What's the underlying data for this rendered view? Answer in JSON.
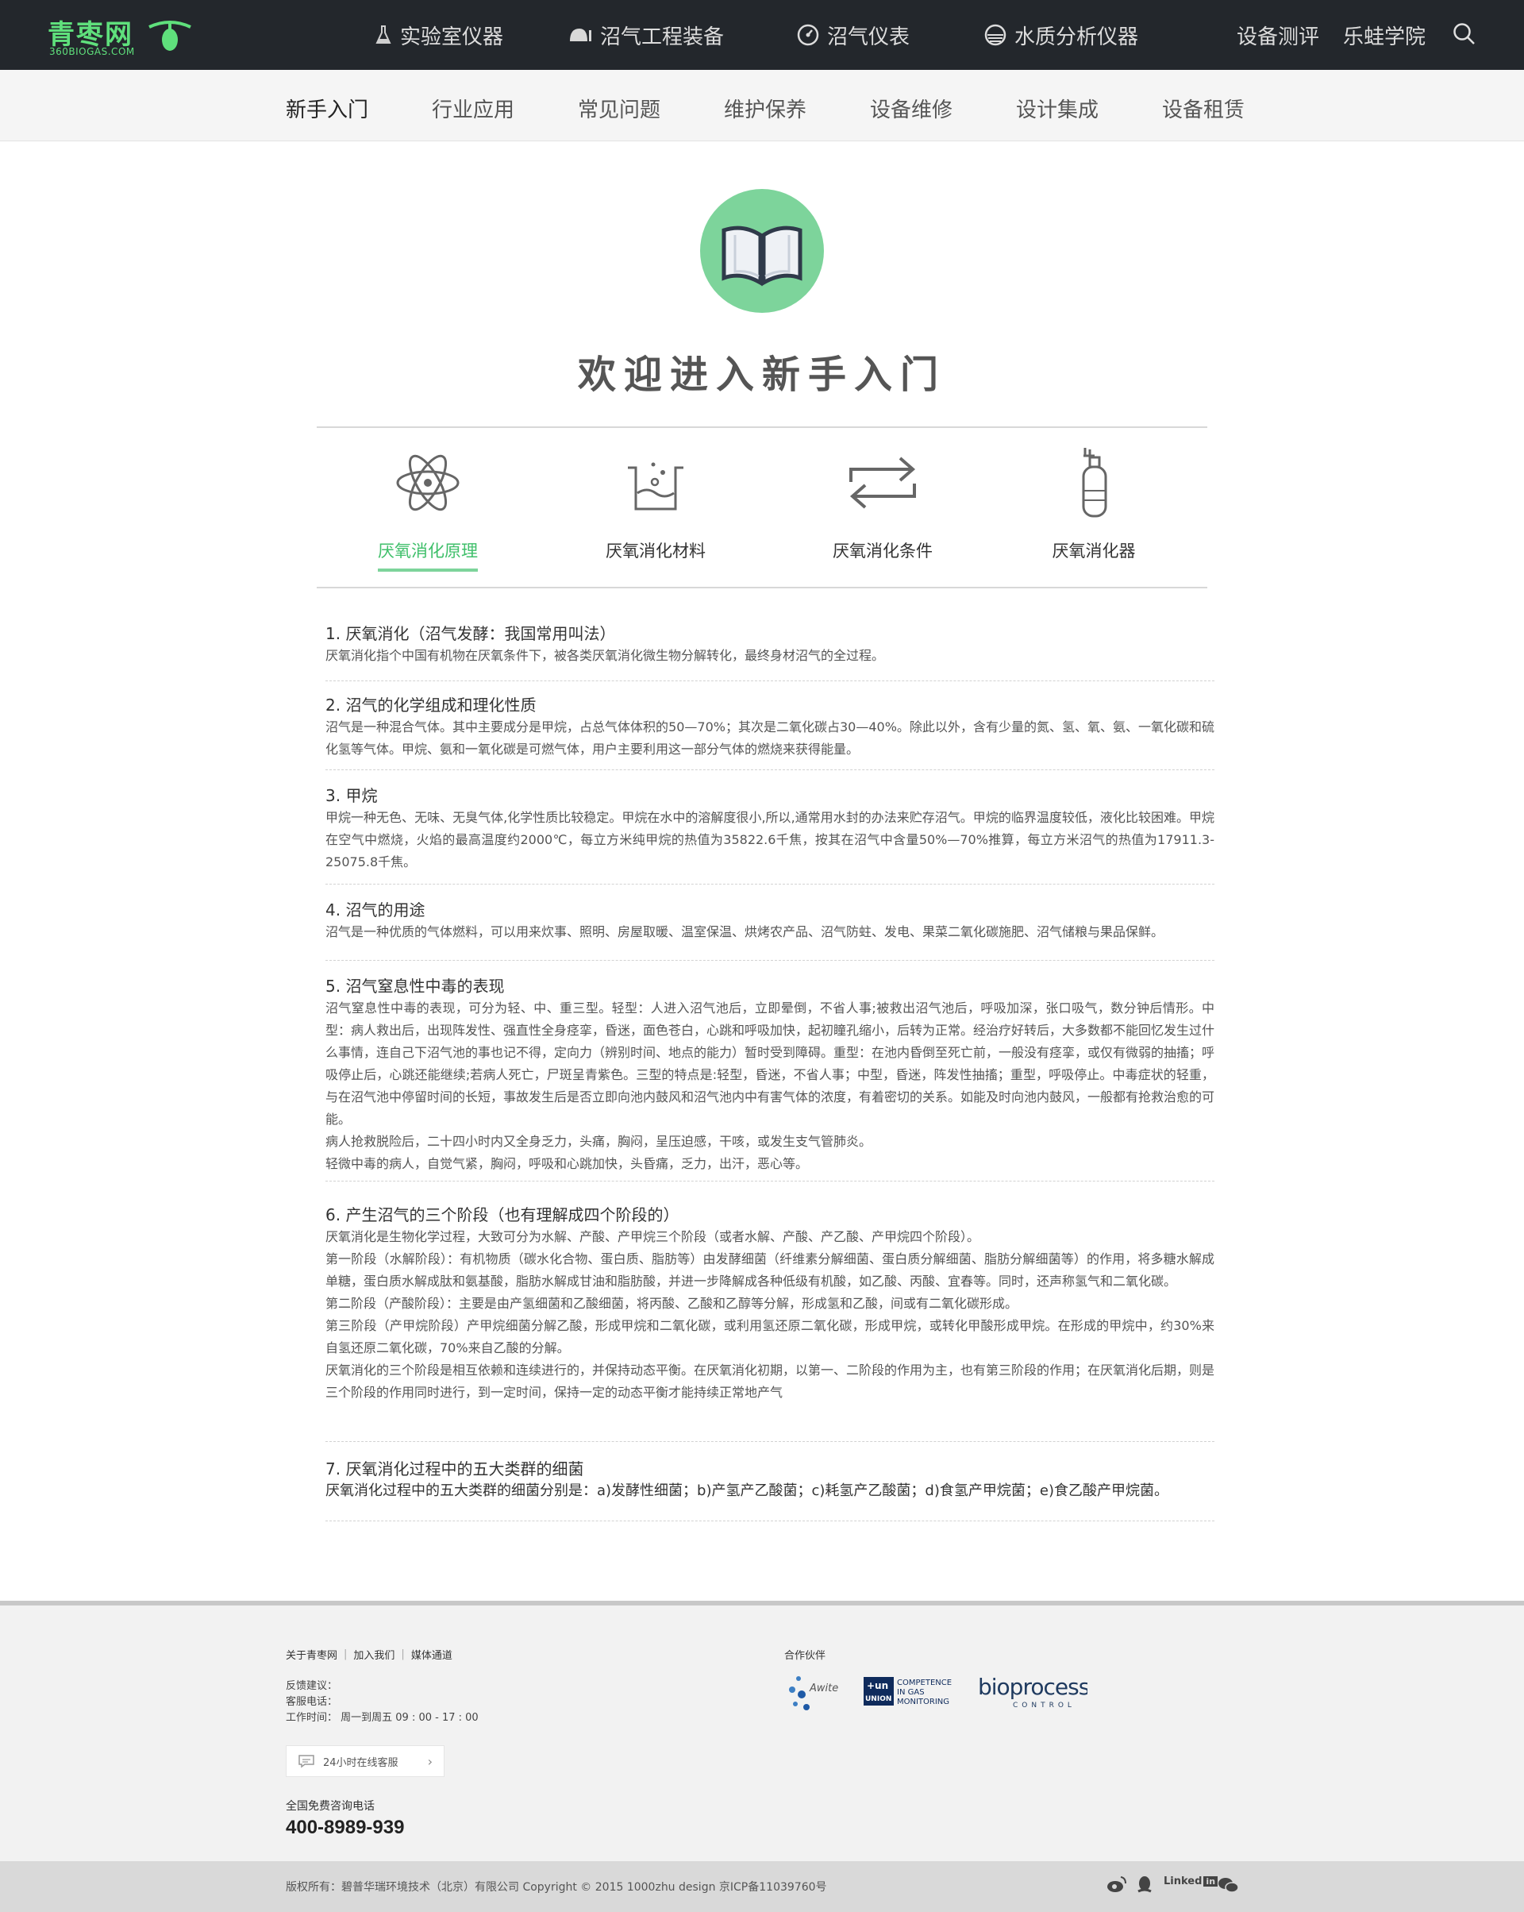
{
  "logo": {
    "cn": "青枣网",
    "en": "360BIOGAS.COM"
  },
  "topnav": [
    {
      "label": "实验室仪器",
      "icon": "flask-icon"
    },
    {
      "label": "沼气工程装备",
      "icon": "tank-icon"
    },
    {
      "label": "沼气仪表",
      "icon": "gauge-icon"
    },
    {
      "label": "水质分析仪器",
      "icon": "water-icon"
    }
  ],
  "toplinks": [
    "设备测评",
    "乐蛙学院"
  ],
  "subnav": [
    "新手入门",
    "行业应用",
    "常见问题",
    "维护保养",
    "设备维修",
    "设计集成",
    "设备租赁"
  ],
  "hero": {
    "title": "欢迎进入新手入门",
    "icon": "book-icon"
  },
  "categories": [
    {
      "label": "厌氧消化原理",
      "icon": "atom-icon",
      "active": true
    },
    {
      "label": "厌氧消化材料",
      "icon": "beaker-icon",
      "active": false
    },
    {
      "label": "厌氧消化条件",
      "icon": "exchange-icon",
      "active": false
    },
    {
      "label": "厌氧消化器",
      "icon": "gas-cylinder-icon",
      "active": false
    }
  ],
  "sections": [
    {
      "title": "1.   厌氧消化（沼气发酵：我国常用叫法）",
      "paragraphs": [
        "厌氧消化指个中国有机物在厌氧条件下，被各类厌氧消化微生物分解转化，最终身材沼气的全过程。"
      ]
    },
    {
      "title": "2.   沼气的化学组成和理化性质",
      "paragraphs": [
        "沼气是一种混合气体。其中主要成分是甲烷，占总气体体积的50—70%；其次是二氧化碳占30—40%。除此以外，含有少量的氮、氢、氧、氨、一氧化碳和硫化氢等气体。甲烷、氨和一氧化碳是可燃气体，用户主要利用这一部分气体的燃烧来获得能量。"
      ]
    },
    {
      "title": "3.   甲烷",
      "paragraphs": [
        "甲烷一种无色、无味、无臭气体,化学性质比较稳定。甲烷在水中的溶解度很小,所以,通常用水封的办法来贮存沼气。甲烷的临界温度较低，液化比较困难。甲烷在空气中燃烧，火焰的最高温度约2000℃，每立方米纯甲烷的热值为35822.6千焦，按其在沼气中含量50%—70%推算，每立方米沼气的热值为17911.3-25075.8千焦。"
      ]
    },
    {
      "title": "4.   沼气的用途",
      "paragraphs": [
        "沼气是一种优质的气体燃料，可以用来炊事、照明、房屋取暖、温室保温、烘烤农产品、沼气防蛀、发电、果菜二氧化碳施肥、沼气储粮与果品保鲜。"
      ]
    },
    {
      "title": "5.   沼气窒息性中毒的表现",
      "paragraphs": [
        "沼气窒息性中毒的表现，可分为轻、中、重三型。轻型：人进入沼气池后，立即晕倒，不省人事;被救出沼气池后，呼吸加深，张口吸气，数分钟后情形。中型：病人救出后，出现阵发性、强直性全身痉挛，昏迷，面色苍白，心跳和呼吸加快，起初瞳孔缩小，后转为正常。经治疗好转后，大多数都不能回忆发生过什么事情，连自己下沼气池的事也记不得，定向力（辨别时间、地点的能力）暂时受到障碍。重型：在池内昏倒至死亡前，一般没有痉挛，或仅有微弱的抽搐；呼吸停止后，心跳还能继续;若病人死亡，尸斑呈青紫色。三型的特点是:轻型，昏迷，不省人事；中型，昏迷，阵发性抽搐；重型，呼吸停止。中毒症状的轻重，与在沼气池中停留时间的长短，事故发生后是否立即向池内鼓风和沼气池内中有害气体的浓度，有着密切的关系。如能及时向池内鼓风，一般都有抢救治愈的可能。",
        "病人抢救脱险后，二十四小时内又全身乏力，头痛，胸闷，呈压迫感，干咳，或发生支气管肺炎。",
        "轻微中毒的病人，自觉气紧，胸闷，呼吸和心跳加快，头昏痛，乏力，出汗，恶心等。"
      ]
    },
    {
      "title": "6.   产生沼气的三个阶段（也有理解成四个阶段的）",
      "paragraphs": [
        "厌氧消化是生物化学过程，大致可分为水解、产酸、产甲烷三个阶段（或者水解、产酸、产乙酸、产甲烷四个阶段）。",
        "第一阶段（水解阶段）：有机物质（碳水化合物、蛋白质、脂肪等）由发酵细菌（纤维素分解细菌、蛋白质分解细菌、脂肪分解细菌等）的作用，将多糖水解成单糖，蛋白质水解成肽和氨基酸，脂肪水解成甘油和脂肪酸，并进一步降解成各种低级有机酸，如乙酸、丙酸、宜春等。同时，还声称氢气和二氧化碳。",
        "第二阶段（产酸阶段）：主要是由产氢细菌和乙酸细菌，将丙酸、乙酸和乙醇等分解，形成氢和乙酸，间或有二氧化碳形成。",
        "第三阶段（产甲烷阶段）产甲烷细菌分解乙酸，形成甲烷和二氧化碳，或利用氢还原二氧化碳，形成甲烷，或转化甲酸形成甲烷。在形成的甲烷中，约30%来自氢还原二氧化碳，70%来自乙酸的分解。",
        "厌氧消化的三个阶段是相互依赖和连续进行的，并保持动态平衡。在厌氧消化初期，以第一、二阶段的作用为主，也有第三阶段的作用；在厌氧消化后期，则是三个阶段的作用同时进行，到一定时间，保持一定的动态平衡才能持续正常地产气"
      ]
    },
    {
      "title": "7.   厌氧消化过程中的五大类群的细菌",
      "paragraphs": [
        "厌氧消化过程中的五大类群的细菌分别是：a)发酵性细菌；b)产氢产乙酸菌；c)耗氢产乙酸菌；d)食氢产甲烷菌；e)食乙酸产甲烷菌。"
      ]
    }
  ],
  "footer": {
    "links": [
      "关于青枣网",
      "加入我们",
      "媒体通道"
    ],
    "feedback": "反馈建议：",
    "service_phone": "客服电话：",
    "hours": "工作时间：  周一到周五 09 : 00 - 17 : 00",
    "chat_button": "24小时在线客服",
    "hotline_label": "全国免费咨询电话",
    "hotline": "400-8989-939",
    "partners_label": "合作伙伴",
    "partners": [
      "Awite",
      "UNION COMPETENCE IN GAS MONITORING",
      "bioprocess CONTROL"
    ],
    "copyright": "版权所有：碧普华瑞环境技术（北京）有限公司    Copyright © 2015 1000zhu design 京ICP备11039760号",
    "social": [
      "weibo-icon",
      "qq-icon",
      "linkedin-icon",
      "wechat-icon"
    ],
    "linkedin_text": "Linked"
  },
  "colors": {
    "topbar": "#23272c",
    "brand_green": "#5fe07c",
    "accent_green": "#7dd49b"
  }
}
